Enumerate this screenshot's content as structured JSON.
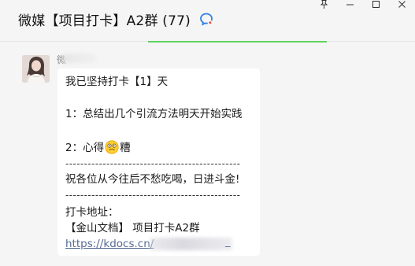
{
  "window": {
    "title": "微媒【项目打卡】A2群 (77)",
    "controls": [
      {
        "name": "pin",
        "icon": "pin-icon"
      },
      {
        "name": "minimize",
        "icon": "minimize-icon"
      },
      {
        "name": "maximize",
        "icon": "maximize-icon"
      },
      {
        "name": "close",
        "icon": "close-icon"
      }
    ]
  },
  "message": {
    "sender_name": "微",
    "lines": {
      "l1": "我已坚持打卡【1】天",
      "l2": "1：总结出几个引流方法明天开始实践",
      "l3a": "2：心得",
      "l3b": "糟",
      "dash1": "-----------------------------------------------",
      "l4": "祝各位从今往后不愁吃喝，日进斗金!",
      "dash2": "-----------------------------------------------",
      "l5": "打卡地址：",
      "l6": "【金山文档】 项目打卡A2群",
      "link": "https://kdocs.cn/",
      "link_tail": "_"
    }
  },
  "colors": {
    "background": "#f5f5f5",
    "bubble": "#ffffff",
    "link": "#576b95",
    "accent_green": "#5fd35f"
  }
}
